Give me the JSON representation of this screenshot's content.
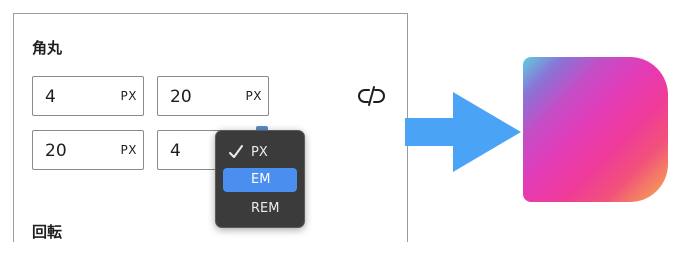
{
  "panel": {
    "corner_title": "角丸",
    "rotate_title": "回転",
    "fields": [
      {
        "value": "4",
        "unit": "PX"
      },
      {
        "value": "20",
        "unit": "PX"
      },
      {
        "value": "20",
        "unit": "PX"
      },
      {
        "value": "4",
        "unit": ""
      }
    ]
  },
  "unit_menu": {
    "items": [
      "PX",
      "EM",
      "REM"
    ],
    "checked": "PX",
    "highlighted": "EM"
  },
  "colors": {
    "arrow": "#4aa3f5",
    "menu_bg": "#3b3b3b",
    "menu_highlight": "#4a8ff0",
    "gradient": [
      "#5fcde0",
      "#8a74d6",
      "#c14fc7",
      "#e33bb7",
      "#ee3a9a",
      "#f2527a",
      "#f6b24a"
    ]
  },
  "icons": [
    "unlink-icon",
    "checkmark-icon",
    "right-arrow-icon"
  ]
}
